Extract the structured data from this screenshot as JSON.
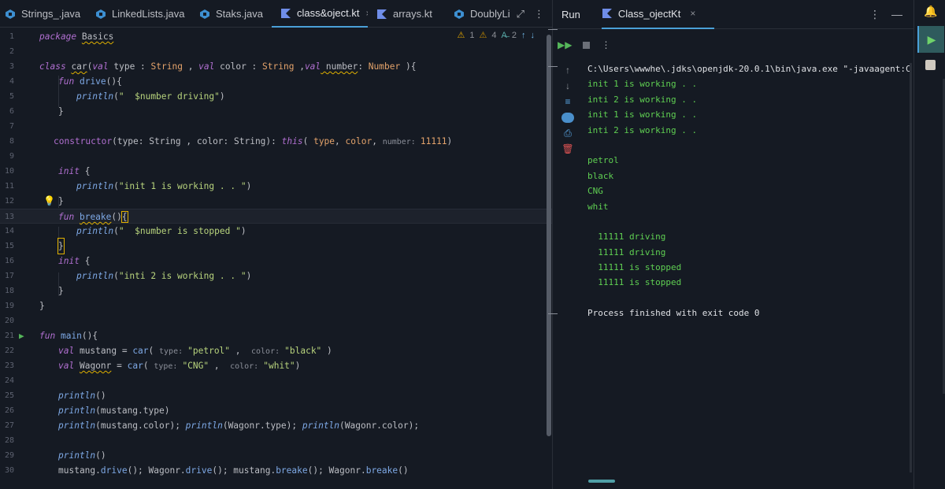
{
  "tabs": [
    {
      "label": "Strings_.java",
      "icon": "java-class-icon"
    },
    {
      "label": "LinkedLists.java",
      "icon": "java-class-icon"
    },
    {
      "label": "Staks.java",
      "icon": "java-class-icon"
    },
    {
      "label": "class&oject.kt",
      "icon": "kotlin-file-icon",
      "active": true,
      "close": "×"
    },
    {
      "label": "arrays.kt",
      "icon": "kotlin-file-icon"
    },
    {
      "label": "DoublyLink",
      "icon": "java-class-icon"
    }
  ],
  "tab_actions": {
    "expand": "⤢",
    "more": "⋮"
  },
  "indicators": {
    "warnings": "1",
    "weak_warnings": "4",
    "typos": "2"
  },
  "lines": [
    {
      "n": "1"
    },
    {
      "n": "2"
    },
    {
      "n": "3"
    },
    {
      "n": "4"
    },
    {
      "n": "5"
    },
    {
      "n": "6"
    },
    {
      "n": "7"
    },
    {
      "n": "8"
    },
    {
      "n": "9"
    },
    {
      "n": "10"
    },
    {
      "n": "11"
    },
    {
      "n": "12"
    },
    {
      "n": "13"
    },
    {
      "n": "14"
    },
    {
      "n": "15"
    },
    {
      "n": "16"
    },
    {
      "n": "17"
    },
    {
      "n": "18"
    },
    {
      "n": "19"
    },
    {
      "n": "20"
    },
    {
      "n": "21"
    },
    {
      "n": "22"
    },
    {
      "n": "23"
    },
    {
      "n": "24"
    },
    {
      "n": "25"
    },
    {
      "n": "26"
    },
    {
      "n": "27"
    },
    {
      "n": "28"
    },
    {
      "n": "29"
    },
    {
      "n": "30"
    }
  ],
  "code": {
    "l1": {
      "kw": "package",
      "name": "Basics"
    },
    "l3": {
      "kw": "class",
      "name": "car",
      "p1": "(",
      "v1": "val",
      "type": " type ",
      "c1": ": ",
      "t1": "String",
      "s1": " , ",
      "v2": "val",
      "color": " color ",
      "c2": ": ",
      "t2": "String",
      "s2": " ,",
      "v3": "val",
      "number": " number",
      "c3": ": ",
      "t3": "Number",
      "end": " ){"
    },
    "l4": {
      "kw": "fun",
      "name": "drive",
      "end": "(){"
    },
    "l5": {
      "fn": "println",
      "open": "(",
      "str": "\"  $number driving\"",
      "close": ")"
    },
    "l6": {
      "text": "}"
    },
    "l8": {
      "kw": "constructor",
      "p": "(type: String , color: String): ",
      "this": "this",
      "open": "( ",
      "a1": "type",
      "s1": ", ",
      "a2": "color",
      "s2": ", ",
      "hint": "number: ",
      "num": "11111",
      "close": ")"
    },
    "l10": {
      "kw": "init",
      "end": " {"
    },
    "l11": {
      "fn": "println",
      "open": "(",
      "str": "\"init 1 is working . . \"",
      "close": ")"
    },
    "l12": {
      "text": "}"
    },
    "l13": {
      "kw": "fun",
      "name": "breake",
      "end": "()",
      "brace": "{"
    },
    "l14": {
      "fn": "println",
      "open": "(",
      "str": "\"  $number is stopped \"",
      "close": ")"
    },
    "l15": {
      "text": "}"
    },
    "l16": {
      "kw": "init",
      "end": " {"
    },
    "l17": {
      "fn": "println",
      "open": "(",
      "str": "\"inti 2 is working . . \"",
      "close": ")"
    },
    "l18": {
      "text": "}"
    },
    "l19": {
      "text": "}"
    },
    "l21": {
      "kw": "fun",
      "name": "main",
      "end": "(){"
    },
    "l22": {
      "kw": "val",
      "name": " mustang = ",
      "fn": "car",
      "open": "( ",
      "h1": "type: ",
      "s1": "\"petrol\"",
      "sep": " ,  ",
      "h2": "color: ",
      "s2": "\"black\"",
      "close": " )"
    },
    "l23": {
      "kw": "val",
      "sp": " ",
      "name": "Wagonr",
      "eq": " = ",
      "fn": "car",
      "open": "( ",
      "h1": "type: ",
      "s1": "\"CNG\"",
      "sep": " ,  ",
      "h2": "color: ",
      "s2": "\"whit\"",
      "close": ")"
    },
    "l25": {
      "fn": "println",
      "rest": "()"
    },
    "l26": {
      "fn": "println",
      "rest": "(mustang.type)"
    },
    "l27": {
      "f1": "println",
      "r1": "(mustang.color); ",
      "f2": "println",
      "r2": "(Wagonr.type); ",
      "f3": "println",
      "r3": "(Wagonr.color);"
    },
    "l29": {
      "fn": "println",
      "rest": "()"
    },
    "l30": {
      "a": "mustang.",
      "f1": "drive",
      "b": "(); Wagonr.",
      "f2": "drive",
      "c": "(); mustang.",
      "f3": "breake",
      "d": "(); Wagonr.",
      "f4": "breake",
      "e": "()"
    }
  },
  "run": {
    "title": "Run",
    "tab_label": "Class_ojectKt",
    "tab_close": "×",
    "more": "⋮",
    "minimize": "—",
    "console": [
      {
        "text": "C:\\Users\\wwwhe\\.jdks\\openjdk-20.0.1\\bin\\java.exe \"-javaagent:C:\\Program",
        "color": "white"
      },
      {
        "text": "init 1 is working . .",
        "color": "green"
      },
      {
        "text": "inti 2 is working . .",
        "color": "green"
      },
      {
        "text": "init 1 is working . .",
        "color": "green"
      },
      {
        "text": "inti 2 is working . .",
        "color": "green"
      },
      {
        "text": "",
        "color": "green"
      },
      {
        "text": "petrol",
        "color": "green"
      },
      {
        "text": "black",
        "color": "green"
      },
      {
        "text": "CNG",
        "color": "green"
      },
      {
        "text": "whit",
        "color": "green"
      },
      {
        "text": "",
        "color": "green"
      },
      {
        "text": "  11111 driving",
        "color": "green"
      },
      {
        "text": "  11111 driving",
        "color": "green"
      },
      {
        "text": "  11111 is stopped",
        "color": "green"
      },
      {
        "text": "  11111 is stopped",
        "color": "green"
      },
      {
        "text": "",
        "color": "green"
      },
      {
        "text": "Process finished with exit code 0",
        "color": "white"
      }
    ]
  },
  "colors": {
    "accent": "#4aa0d8",
    "green": "#5fcf52",
    "background": "#151a23"
  }
}
